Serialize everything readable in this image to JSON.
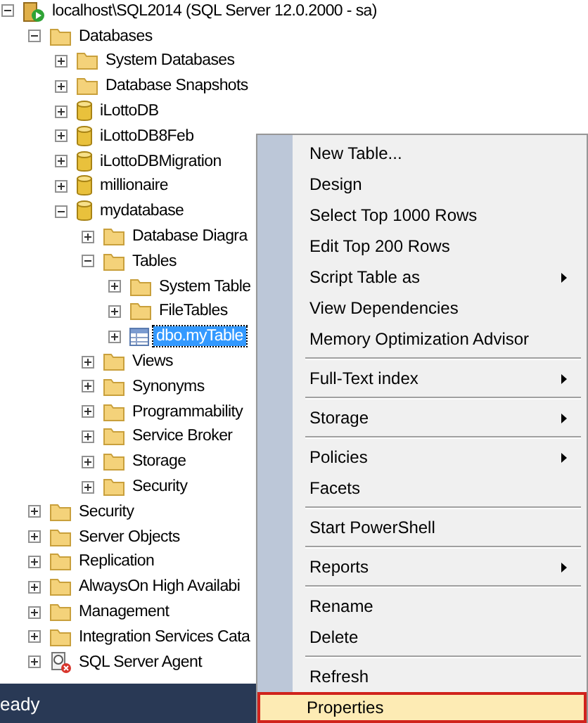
{
  "tree": [
    {
      "label": "localhost\\SQL2014 (SQL Server 12.0.2000 - sa)",
      "kind": "server",
      "expanded": true,
      "selected": false,
      "children": [
        {
          "label": "Databases",
          "kind": "folder",
          "expanded": true,
          "selected": false,
          "children": [
            {
              "label": "System Databases",
              "kind": "folder",
              "expanded": false,
              "selected": false
            },
            {
              "label": "Database Snapshots",
              "kind": "folder",
              "expanded": false,
              "selected": false
            },
            {
              "label": "iLottoDB",
              "kind": "database",
              "expanded": false,
              "selected": false
            },
            {
              "label": "iLottoDB8Feb",
              "kind": "database",
              "expanded": false,
              "selected": false
            },
            {
              "label": "iLottoDBMigration",
              "kind": "database",
              "expanded": false,
              "selected": false
            },
            {
              "label": "millionaire",
              "kind": "database",
              "expanded": false,
              "selected": false
            },
            {
              "label": "mydatabase",
              "kind": "database",
              "expanded": true,
              "selected": false,
              "children": [
                {
                  "label": "Database Diagra",
                  "kind": "folder",
                  "expanded": false,
                  "selected": false
                },
                {
                  "label": "Tables",
                  "kind": "folder",
                  "expanded": true,
                  "selected": false,
                  "children": [
                    {
                      "label": "System Table",
                      "kind": "folder",
                      "expanded": false,
                      "selected": false
                    },
                    {
                      "label": "FileTables",
                      "kind": "folder",
                      "expanded": false,
                      "selected": false
                    },
                    {
                      "label": "dbo.myTable",
                      "kind": "table",
                      "expanded": false,
                      "selected": true
                    }
                  ]
                },
                {
                  "label": "Views",
                  "kind": "folder",
                  "expanded": false,
                  "selected": false
                },
                {
                  "label": "Synonyms",
                  "kind": "folder",
                  "expanded": false,
                  "selected": false
                },
                {
                  "label": "Programmability",
                  "kind": "folder",
                  "expanded": false,
                  "selected": false
                },
                {
                  "label": "Service Broker",
                  "kind": "folder",
                  "expanded": false,
                  "selected": false
                },
                {
                  "label": "Storage",
                  "kind": "folder",
                  "expanded": false,
                  "selected": false
                },
                {
                  "label": "Security",
                  "kind": "folder",
                  "expanded": false,
                  "selected": false
                }
              ]
            }
          ]
        },
        {
          "label": "Security",
          "kind": "folder",
          "expanded": false,
          "selected": false
        },
        {
          "label": "Server Objects",
          "kind": "folder",
          "expanded": false,
          "selected": false
        },
        {
          "label": "Replication",
          "kind": "folder",
          "expanded": false,
          "selected": false
        },
        {
          "label": "AlwaysOn High Availabi",
          "kind": "folder",
          "expanded": false,
          "selected": false
        },
        {
          "label": "Management",
          "kind": "folder",
          "expanded": false,
          "selected": false
        },
        {
          "label": "Integration Services Cata",
          "kind": "folder",
          "expanded": false,
          "selected": false
        },
        {
          "label": "SQL Server Agent",
          "kind": "agent",
          "expanded": false,
          "selected": false
        }
      ]
    }
  ],
  "context_menu": {
    "groups": [
      [
        {
          "label": "New Table...",
          "submenu": false,
          "selected": false
        },
        {
          "label": "Design",
          "submenu": false,
          "selected": false
        },
        {
          "label": "Select Top 1000 Rows",
          "submenu": false,
          "selected": false
        },
        {
          "label": "Edit Top 200 Rows",
          "submenu": false,
          "selected": false
        },
        {
          "label": "Script Table as",
          "submenu": true,
          "selected": false
        },
        {
          "label": "View Dependencies",
          "submenu": false,
          "selected": false
        },
        {
          "label": "Memory Optimization Advisor",
          "submenu": false,
          "selected": false
        }
      ],
      [
        {
          "label": "Full-Text index",
          "submenu": true,
          "selected": false
        }
      ],
      [
        {
          "label": "Storage",
          "submenu": true,
          "selected": false
        }
      ],
      [
        {
          "label": "Policies",
          "submenu": true,
          "selected": false
        },
        {
          "label": "Facets",
          "submenu": false,
          "selected": false
        }
      ],
      [
        {
          "label": "Start PowerShell",
          "submenu": false,
          "selected": false
        }
      ],
      [
        {
          "label": "Reports",
          "submenu": true,
          "selected": false
        }
      ],
      [
        {
          "label": "Rename",
          "submenu": false,
          "selected": false
        },
        {
          "label": "Delete",
          "submenu": false,
          "selected": false
        }
      ],
      [
        {
          "label": "Refresh",
          "submenu": false,
          "selected": false
        },
        {
          "label": "Properties",
          "submenu": false,
          "selected": true
        }
      ]
    ]
  },
  "status_bar": {
    "text": "eady"
  }
}
